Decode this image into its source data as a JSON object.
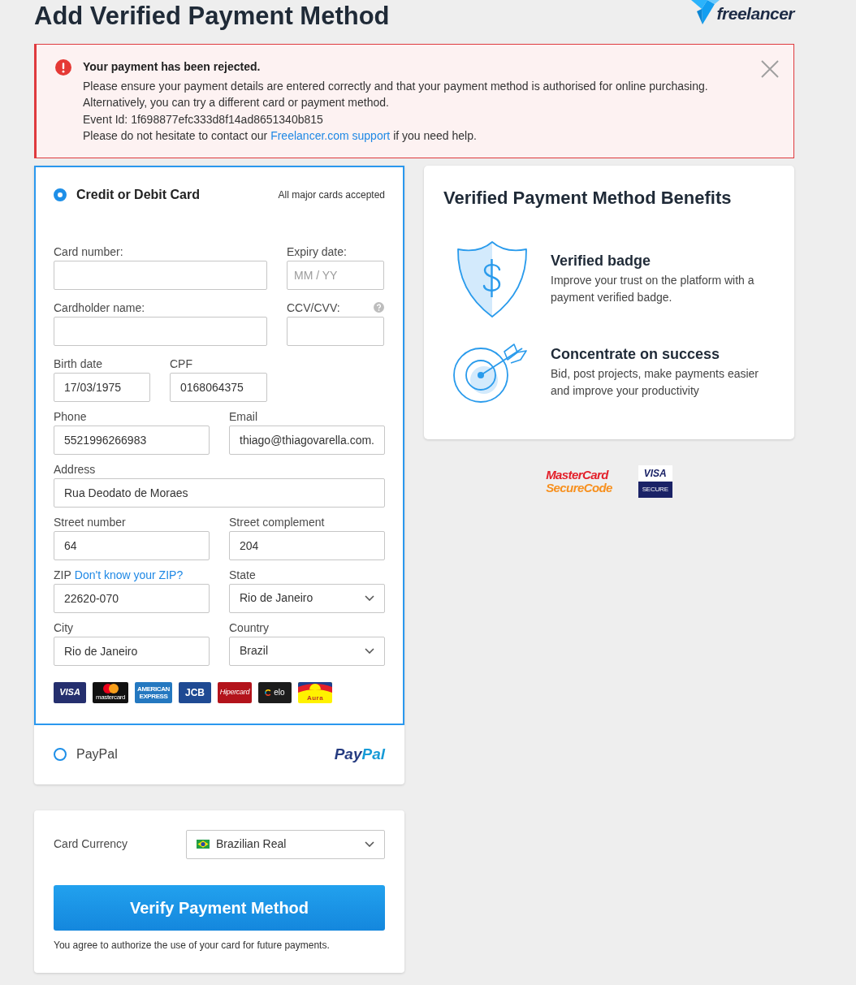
{
  "header": {
    "title": "Add Verified Payment Method",
    "logo_text": "freelancer"
  },
  "alert": {
    "kind": "error",
    "title": "Your payment has been rejected.",
    "lines": [
      "Please ensure your payment details are entered correctly and that your payment method is authorised for online purchasing.",
      "Alternatively, you can try a different card or payment method.",
      "Event Id: 1f698877efc333d8f14ad8651340b815"
    ],
    "contact": {
      "before": "Please do not hesitate to contact our",
      "link": "Freelancer.com support",
      "after": "if you need help."
    }
  },
  "payment_methods": [
    {
      "kind": "card",
      "label": "Credit or Debit Card",
      "selected": true,
      "note": "All major cards accepted",
      "form_rows": [
        {
          "kind": "wide-narrow",
          "fields": [
            {
              "kind": "text",
              "label": "Card number:"
            },
            {
              "kind": "text",
              "label": "Expiry date:",
              "placeholder": "MM / YY"
            }
          ]
        },
        {
          "kind": "wide-narrow",
          "fields": [
            {
              "kind": "text",
              "label": "Cardholder name:"
            },
            {
              "kind": "text",
              "label": "CCV/CVV:",
              "help": true
            }
          ]
        },
        {
          "kind": "narrow-pair",
          "fields": [
            {
              "kind": "text",
              "label": "Birth date",
              "value": "17/03/1975"
            },
            {
              "kind": "text",
              "label": "CPF",
              "value": "0168064375"
            }
          ]
        },
        {
          "kind": "pair",
          "fields": [
            {
              "kind": "text",
              "label": "Phone",
              "value": "5521996266983"
            },
            {
              "kind": "text",
              "label": "Email",
              "value": "thiago@thiagovarella.com."
            }
          ]
        },
        {
          "kind": "full",
          "fields": [
            {
              "kind": "text",
              "label": "Address",
              "value": "Rua Deodato de Moraes"
            }
          ]
        },
        {
          "kind": "pair",
          "fields": [
            {
              "kind": "text",
              "label": "Street number",
              "value": "64"
            },
            {
              "kind": "text",
              "label": "Street complement",
              "value": "204"
            }
          ]
        },
        {
          "kind": "pair",
          "fields": [
            {
              "kind": "text",
              "label": "ZIP",
              "label_link": "Don't know your ZIP?",
              "value": "22620-070"
            },
            {
              "kind": "select",
              "label": "State",
              "value": "Rio de Janeiro"
            }
          ]
        },
        {
          "kind": "pair",
          "fields": [
            {
              "kind": "text",
              "label": "City",
              "value": "Rio de Janeiro"
            },
            {
              "kind": "select",
              "label": "Country",
              "value": "Brazil"
            }
          ]
        }
      ],
      "card_brands": [
        {
          "kind": "visa",
          "label": "VISA"
        },
        {
          "kind": "mastercard",
          "label": "mastercard"
        },
        {
          "kind": "amex",
          "label": "AMERICAN EXPRESS"
        },
        {
          "kind": "jcb",
          "label": "JCB"
        },
        {
          "kind": "hipercard",
          "label": "Hipercard"
        },
        {
          "kind": "elo",
          "label": "elo"
        },
        {
          "kind": "aura",
          "label": "Aura"
        }
      ]
    },
    {
      "kind": "paypal",
      "label": "PayPal",
      "selected": false,
      "logo_parts": [
        "Pay",
        "Pal"
      ]
    }
  ],
  "currency": {
    "label": "Card Currency",
    "value": "Brazilian Real"
  },
  "submit": {
    "label": "Verify Payment Method",
    "agreement": "You agree to authorize the use of your card for future payments."
  },
  "benefits": {
    "title": "Verified Payment Method Benefits",
    "items": [
      {
        "kind": "shield",
        "title": "Verified badge",
        "text": "Improve your trust on the platform with a payment verified badge."
      },
      {
        "kind": "target",
        "title": "Concentrate on success",
        "text": "Bid, post projects, make payments easier and improve your productivity"
      }
    ]
  },
  "security_badges": [
    {
      "kind": "mastercard",
      "lines": [
        "MasterCard",
        "SecureCode"
      ]
    },
    {
      "kind": "visa",
      "lines": [
        "VISA",
        "SECURE"
      ]
    }
  ]
}
